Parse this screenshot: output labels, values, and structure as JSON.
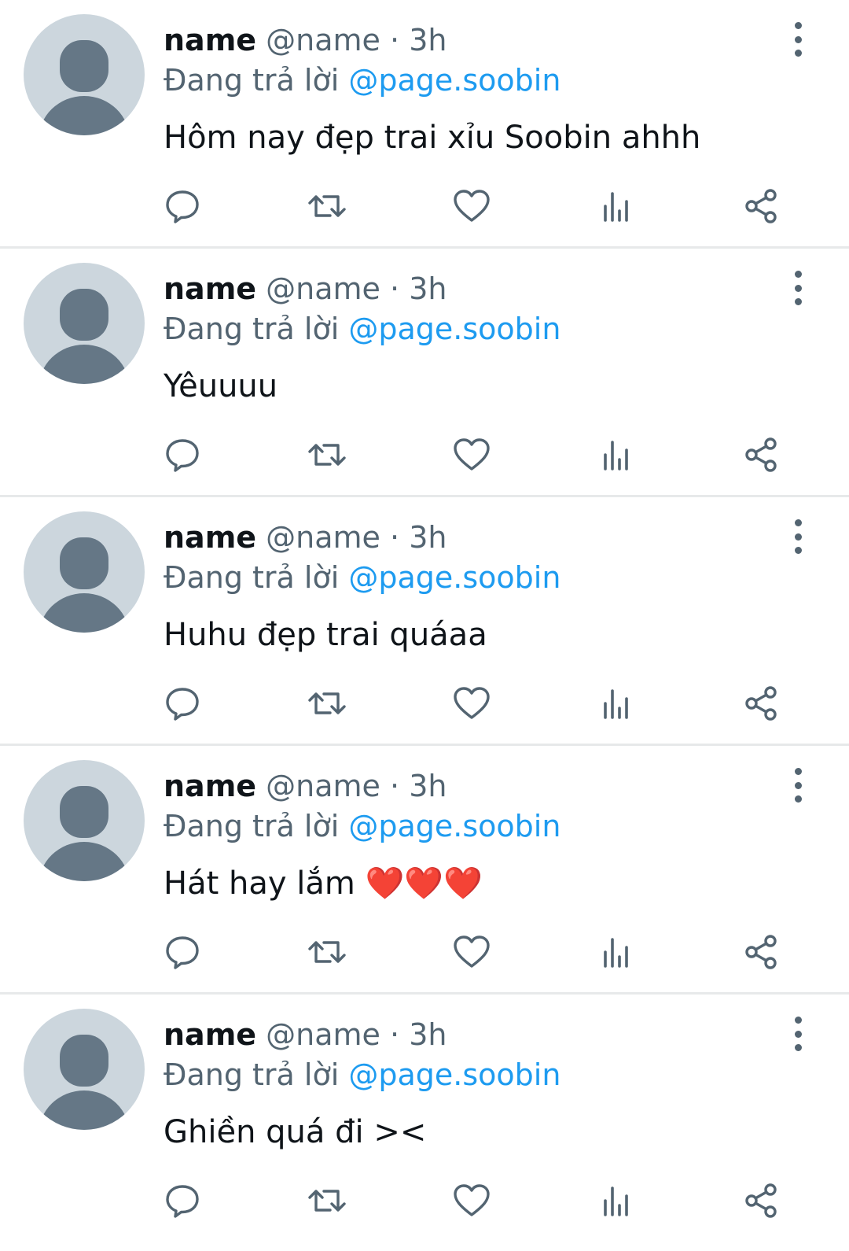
{
  "replies": [
    {
      "display_name": "name",
      "handle": "@name",
      "separator": "·",
      "time": "3h",
      "replying_prefix": "Đang trả lời",
      "replying_to": "@page.soobin",
      "text": "Hôm nay đẹp trai xỉu Soobin ahhh"
    },
    {
      "display_name": "name",
      "handle": "@name",
      "separator": "·",
      "time": "3h",
      "replying_prefix": "Đang trả lời",
      "replying_to": "@page.soobin",
      "text": "Yêuuuu"
    },
    {
      "display_name": "name",
      "handle": "@name",
      "separator": "·",
      "time": "3h",
      "replying_prefix": "Đang trả lời",
      "replying_to": "@page.soobin",
      "text": "Huhu đẹp trai quáaa"
    },
    {
      "display_name": "name",
      "handle": "@name",
      "separator": "·",
      "time": "3h",
      "replying_prefix": "Đang trả lời",
      "replying_to": "@page.soobin",
      "text": "Hát hay lắm ❤️❤️❤️"
    },
    {
      "display_name": "name",
      "handle": "@name",
      "separator": "·",
      "time": "3h",
      "replying_prefix": "Đang trả lời",
      "replying_to": "@page.soobin",
      "text": "Ghiền quá đi ><"
    }
  ],
  "icons": {
    "avatar": "default-avatar-icon",
    "more": "more-vertical-icon",
    "reply": "reply-bubble-icon",
    "retweet": "retweet-icon",
    "like": "heart-icon",
    "views": "views-chart-icon",
    "share": "share-icon"
  },
  "colors": {
    "text_primary": "#0f1419",
    "text_secondary": "#536471",
    "accent": "#1d9bf0",
    "avatar_bg": "#ccd6dd",
    "avatar_fg": "#657786",
    "divider": "#e7e9ea"
  }
}
